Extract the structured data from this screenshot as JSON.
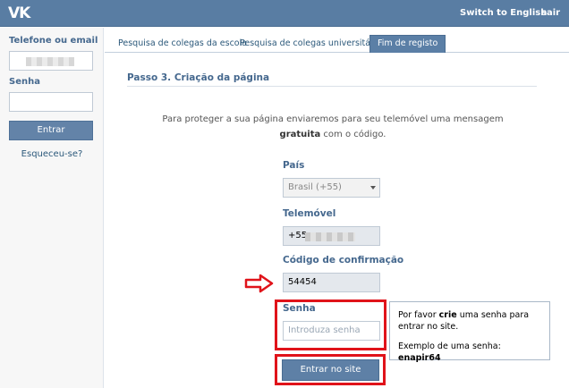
{
  "header": {
    "logo": "VK",
    "switch_language": "Switch to English",
    "exit": "sair"
  },
  "login": {
    "phone_label": "Telefone ou email",
    "password_label": "Senha",
    "submit_label": "Entrar",
    "forgot_label": "Esqueceu-se?"
  },
  "tabs": [
    {
      "label": "Pesquisa de colegas da escola"
    },
    {
      "label": "Pesquisa de colegas universitários"
    },
    {
      "label": "Fim de registo",
      "active": true
    }
  ],
  "main": {
    "step_title": "Passo 3. Criação da página",
    "info_line1": "Para proteger a sua página enviaremos para seu telemóvel uma mensagem",
    "info_bold": "gratuita",
    "info_line2_rest": " com o código.",
    "country_label": "País",
    "country_value": "Brasil (+55)",
    "phone_label": "Telemóvel",
    "phone_prefix": "+55",
    "code_label": "Código de confirmação",
    "code_value": "54454",
    "password_label": "Senha",
    "password_placeholder": "Introduza senha",
    "submit_label": "Entrar no site"
  },
  "tooltip": {
    "line1_pre": "Por favor ",
    "line1_bold": "crie",
    "line1_post": " uma senha para entrar no site.",
    "example_pre": "Exemplo de uma senha: ",
    "example_bold": "enapir64"
  },
  "colors": {
    "header_bg": "#597da3",
    "accent_blue": "#45688e",
    "highlight_red": "#e0131a"
  }
}
